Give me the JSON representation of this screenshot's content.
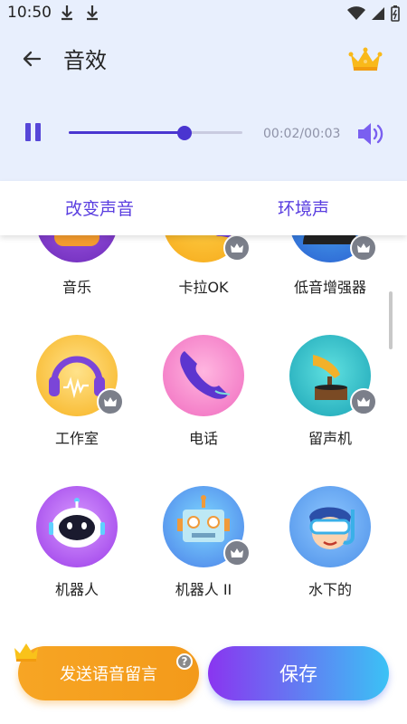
{
  "status_bar": {
    "time": "10:50",
    "download_icons": [
      "download-icon",
      "download-icon"
    ],
    "right_icons": [
      "wifi-icon",
      "signal-icon",
      "battery-icon"
    ]
  },
  "header": {
    "title": "音效",
    "back_icon": "arrow-left-icon",
    "vip_icon": "crown-icon"
  },
  "player": {
    "state_icon": "pause-icon",
    "time": "00:02/00:03",
    "progress": 0.667,
    "volume_icon": "volume-icon"
  },
  "tabs": [
    {
      "label": "改变声音",
      "active": true
    },
    {
      "label": "环境声",
      "active": false
    }
  ],
  "effects": [
    {
      "label": "音乐",
      "vip": false
    },
    {
      "label": "卡拉OK",
      "vip": true
    },
    {
      "label": "低音增强器",
      "vip": true
    },
    {
      "label": "工作室",
      "vip": true
    },
    {
      "label": "电话",
      "vip": false
    },
    {
      "label": "留声机",
      "vip": true
    },
    {
      "label": "机器人",
      "vip": false
    },
    {
      "label": "机器人 II",
      "vip": true
    },
    {
      "label": "水下的",
      "vip": false
    }
  ],
  "footer": {
    "send_label": "发送语音留言",
    "help_badge": "?",
    "save_label": "保存"
  },
  "colors": {
    "accent": "#5a3ee0",
    "header_bg": "#e8effd",
    "send": "#f5a020",
    "save_from": "#8a35f0",
    "save_to": "#3bc2f5"
  }
}
